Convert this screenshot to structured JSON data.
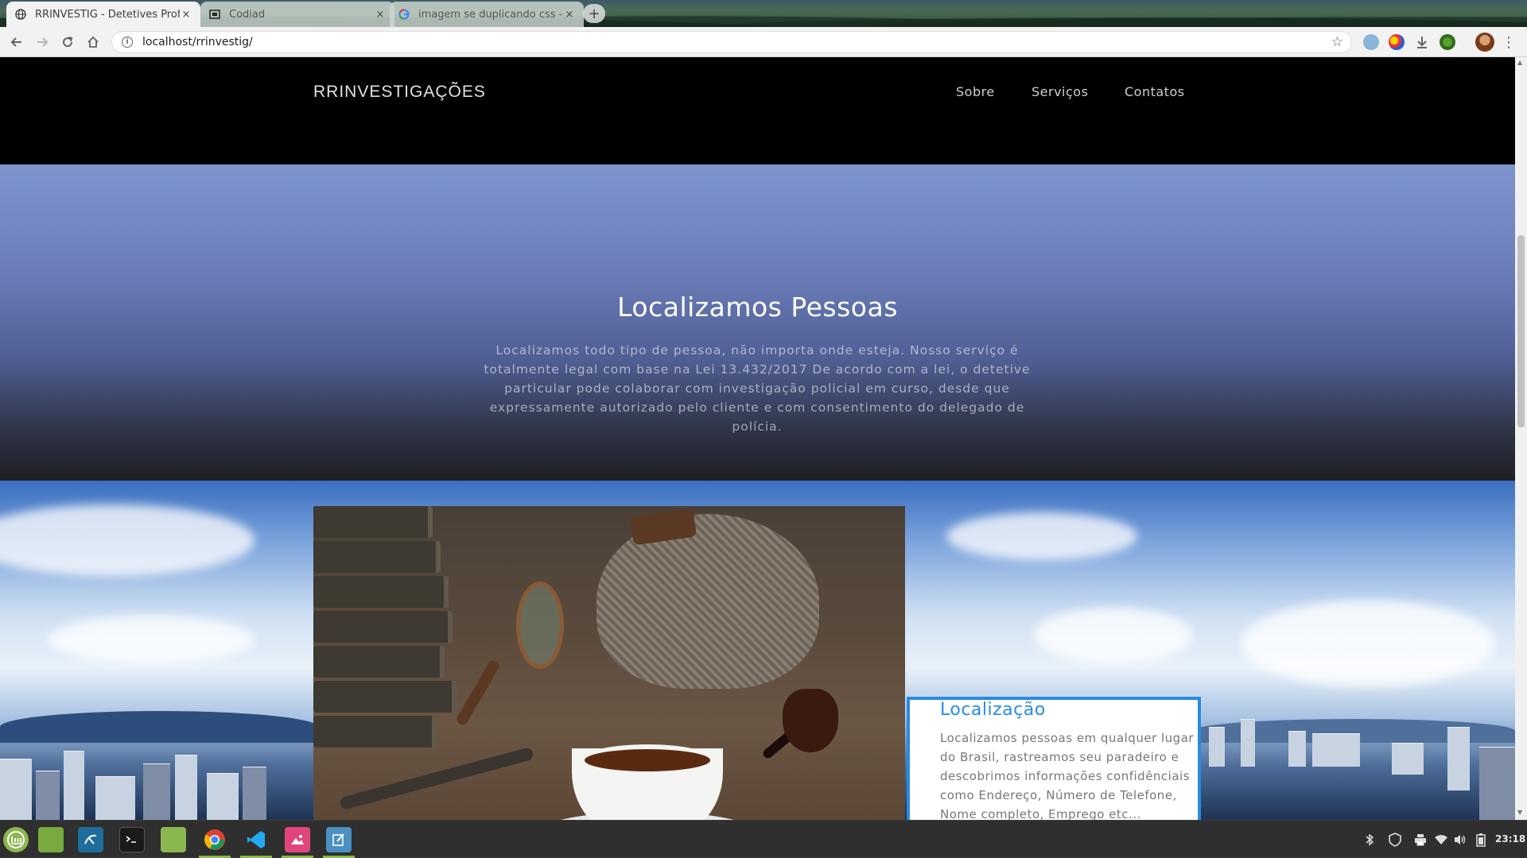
{
  "browser": {
    "tabs": [
      {
        "title": "RRINVESTIG - Detetives Profis",
        "favicon": "globe-icon",
        "active": true
      },
      {
        "title": "Codiad",
        "favicon": "codiad-icon",
        "active": false
      },
      {
        "title": "imagem se duplicando css - G",
        "favicon": "google-icon",
        "active": false
      }
    ],
    "new_tab_symbol": "+",
    "url": "localhost/rrinvestig/",
    "close_symbol": "×"
  },
  "site": {
    "brand": "RRINVESTIGAÇÕES",
    "nav": [
      "Sobre",
      "Serviços",
      "Contatos"
    ],
    "hero": {
      "title": "Localizamos Pessoas",
      "text": "Localizamos todo tipo de pessoa, não importa onde esteja. Nosso serviço é totalmente legal com base na Lei 13.432/2017 De acordo com a lei, o detetive particular pode colaborar com investigação policial em curso, desde que expressamente autorizado pelo cliente e com consentimento do delegado de polícia."
    },
    "card": {
      "title": "Localização",
      "text": "Localizamos pessoas em qualquer lugar do Brasil, rastreamos seu paradeiro e descobrimos informações confidênciais como Endereço, Número de Telefone, Nome completo, Emprego etc..."
    },
    "accent_color": "#2a8be2"
  },
  "taskbar": {
    "apps": [
      "mint-menu-icon",
      "files-icon",
      "mysql-workbench-icon",
      "terminal-icon",
      "folder-icon",
      "chrome-icon",
      "vscode-icon",
      "image-viewer-icon",
      "text-editor-icon"
    ],
    "clock": "23:18"
  }
}
